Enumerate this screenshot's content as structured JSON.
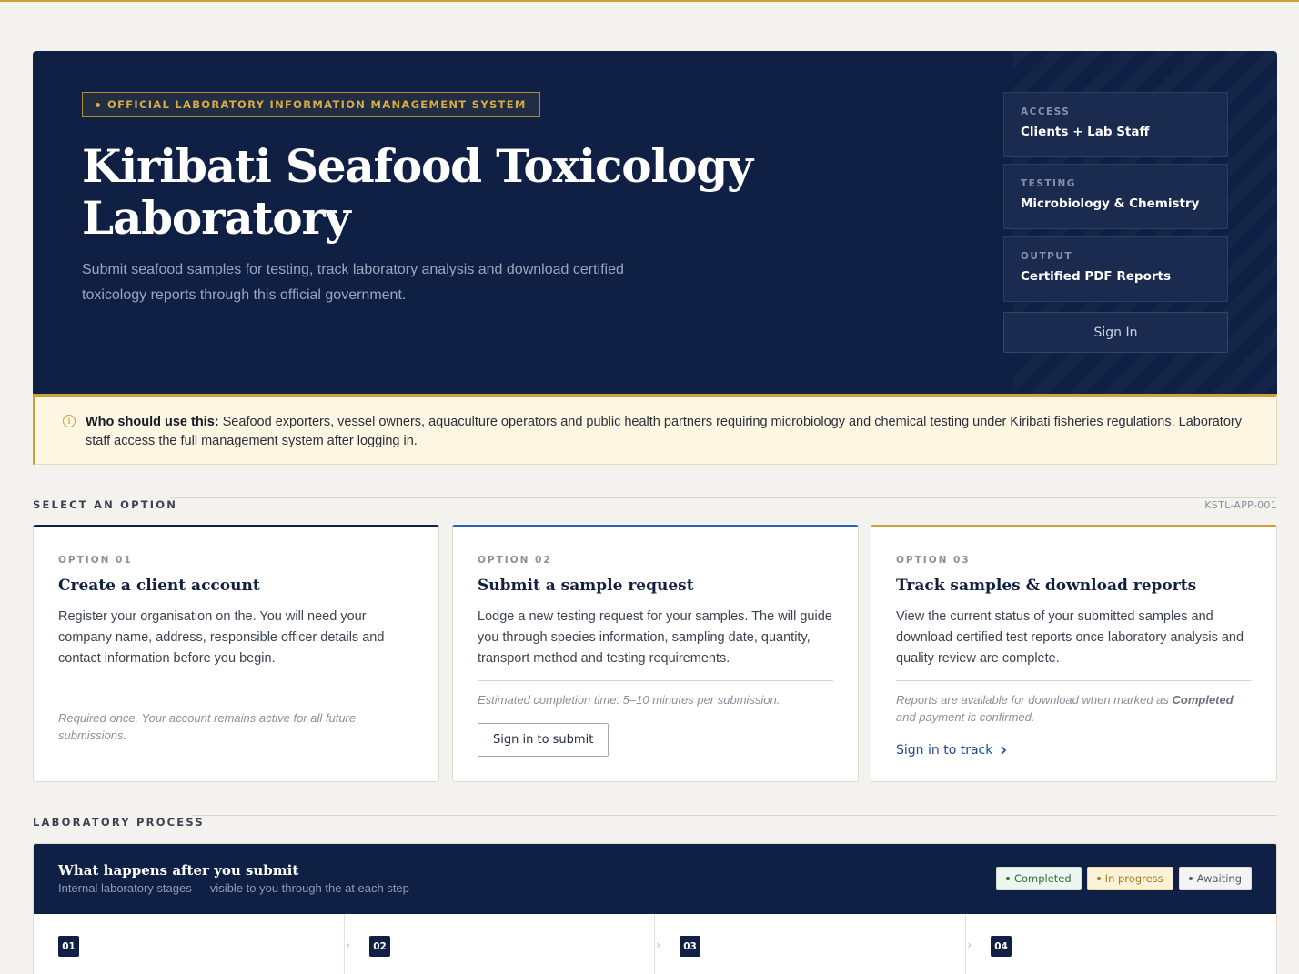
{
  "colors": {
    "navy": "#0f2044",
    "gold": "#c9a23a",
    "page_bg": "#f4f2ee",
    "link_blue": "#1d4a93"
  },
  "hero": {
    "badge": "OFFICIAL LABORATORY INFORMATION MANAGEMENT SYSTEM",
    "title_line1": "Kiribati Seafood Toxicology",
    "title_line2": "Laboratory",
    "subtitle": "Submit seafood samples for testing, track laboratory analysis and download certified toxicology reports through this official government.",
    "info_cards": [
      {
        "label": "ACCESS",
        "value": "Clients + Lab Staff"
      },
      {
        "label": "TESTING",
        "value": "Microbiology & Chemistry"
      },
      {
        "label": "OUTPUT",
        "value": "Certified PDF Reports"
      }
    ],
    "sign_in_label": "Sign In"
  },
  "notice": {
    "icon": "info-icon",
    "lead": "Who should use this:",
    "text": " Seafood exporters, vessel owners, aquaculture operators and public health partners requiring microbiology and chemical testing under Kiribati fisheries regulations. Laboratory staff access the full management system after logging in."
  },
  "options_section": {
    "heading": "SELECT AN OPTION",
    "code": "KSTL-APP-001"
  },
  "options": [
    {
      "number": "OPTION 01",
      "title": "Create a client account",
      "description": "Register your organisation on the. You will need your company name, address, responsible officer details and contact information before you begin.",
      "note": "Required once. Your account remains active for all future submissions.",
      "accent": "#0f2044"
    },
    {
      "number": "OPTION 02",
      "title": "Submit a sample request",
      "description": "Lodge a new testing request for your samples. The will guide you through species information, sampling date, quantity, transport method and testing requirements.",
      "note": "Estimated completion time: 5–10 minutes per submission.",
      "action": "Sign in to submit",
      "accent": "#2f5fb3"
    },
    {
      "number": "OPTION 03",
      "title": "Track samples & download reports",
      "description": "View the current status of your submitted samples and download certified test reports once laboratory analysis and quality review are complete.",
      "note_before": "Reports are available for download when marked as ",
      "note_bold": "Completed",
      "note_after": " and payment is confirmed.",
      "action": "Sign in to track",
      "action_icon": "chevron-right-icon",
      "accent": "#c9a23a"
    }
  ],
  "process": {
    "heading": "LABORATORY PROCESS",
    "title": "What happens after you submit",
    "subtitle": "Internal laboratory stages — visible to you through the at each step",
    "legend": [
      "Completed",
      "In progress",
      "Awaiting"
    ],
    "steps": [
      "01",
      "02",
      "03",
      "04"
    ]
  }
}
